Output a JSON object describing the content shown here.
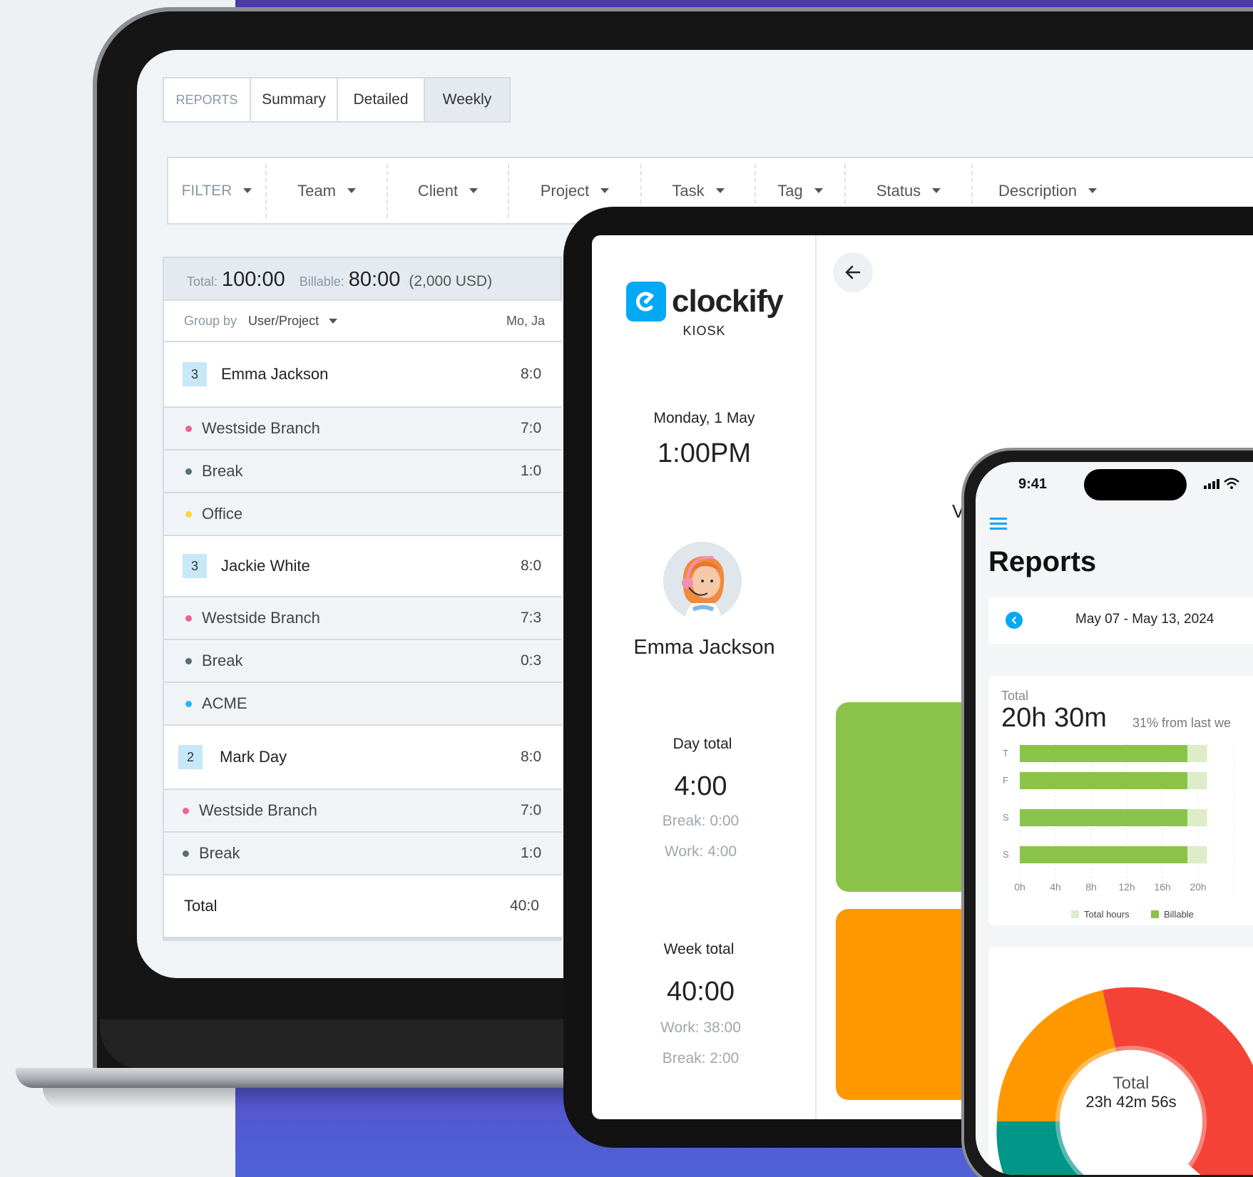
{
  "reports_tabs": [
    "REPORTS",
    "Summary",
    "Detailed",
    "Weekly"
  ],
  "filters": [
    "FILTER",
    "Team",
    "Client",
    "Project",
    "Task",
    "Tag",
    "Status",
    "Description"
  ],
  "totals": {
    "total_label": "Total:",
    "total_value": "100:00",
    "billable_label": "Billable:",
    "billable_value": "80:00",
    "billable_amount": "(2,000 USD)"
  },
  "group_by": {
    "label": "Group by",
    "value": "User/Project",
    "column": "Mo, Ja"
  },
  "rows": [
    {
      "kind": "user",
      "count": "3",
      "name": "Emma Jackson",
      "value": "8:0"
    },
    {
      "kind": "proj",
      "color": "#f06292",
      "name": "Westside Branch",
      "value": "7:0"
    },
    {
      "kind": "proj",
      "color": "#546e7a",
      "name": "Break",
      "value": "1:0"
    },
    {
      "kind": "proj",
      "color": "#fdd835",
      "name": "Office",
      "value": ""
    },
    {
      "kind": "user",
      "count": "3",
      "name": "Jackie White",
      "value": "8:0"
    },
    {
      "kind": "proj",
      "color": "#f06292",
      "name": "Westside Branch",
      "value": "7:3"
    },
    {
      "kind": "proj",
      "color": "#546e7a",
      "name": "Break",
      "value": "0:3"
    },
    {
      "kind": "proj",
      "color": "#29b6f6",
      "name": "ACME",
      "value": ""
    },
    {
      "kind": "user",
      "count": "2",
      "name": "Mark Day",
      "value": "8:0"
    },
    {
      "kind": "proj",
      "color": "#f06292",
      "name": "Westside Branch",
      "value": "7:0"
    },
    {
      "kind": "proj",
      "color": "#546e7a",
      "name": "Break",
      "value": "1:0"
    }
  ],
  "table_total": {
    "label": "Total",
    "value": "40:0"
  },
  "kiosk": {
    "brand": "clockify",
    "kiosk_label": "KIOSK",
    "date": "Monday, 1 May",
    "time": "1:00PM",
    "user_name": "Emma Jackson",
    "day_total_label": "Day total",
    "day_total": "4:00",
    "day_break": "Break: 0:00",
    "day_work": "Work: 4:00",
    "week_total_label": "Week total",
    "week_total": "40:00",
    "week_work": "Work: 38:00",
    "week_break": "Break: 2:00",
    "partial_letter": "V"
  },
  "phone": {
    "status_time": "9:41",
    "title": "Reports",
    "date_range": "May 07 - May 13, 2024",
    "total_label": "Total",
    "total_value": "20h 30m",
    "delta": "31% from last we",
    "donut_label": "Total",
    "donut_value": "23h 42m 56s"
  },
  "colors": {
    "accent": "#03a9f4",
    "green": "#8bc34a",
    "orange": "#ff9800",
    "red": "#f44336",
    "teal": "#009688"
  },
  "chart_data": {
    "type": "bar",
    "orientation": "horizontal",
    "categories": [
      "T",
      "F",
      "S",
      "S"
    ],
    "series": [
      {
        "name": "Total hours",
        "values": [
          21,
          21,
          21,
          21
        ]
      },
      {
        "name": "Billable",
        "values": [
          18.8,
          18.8,
          18.8,
          18.8
        ]
      }
    ],
    "x_ticks": [
      "0h",
      "4h",
      "8h",
      "12h",
      "16h",
      "20h"
    ],
    "xlim": [
      0,
      24
    ],
    "legend": "bottom"
  }
}
